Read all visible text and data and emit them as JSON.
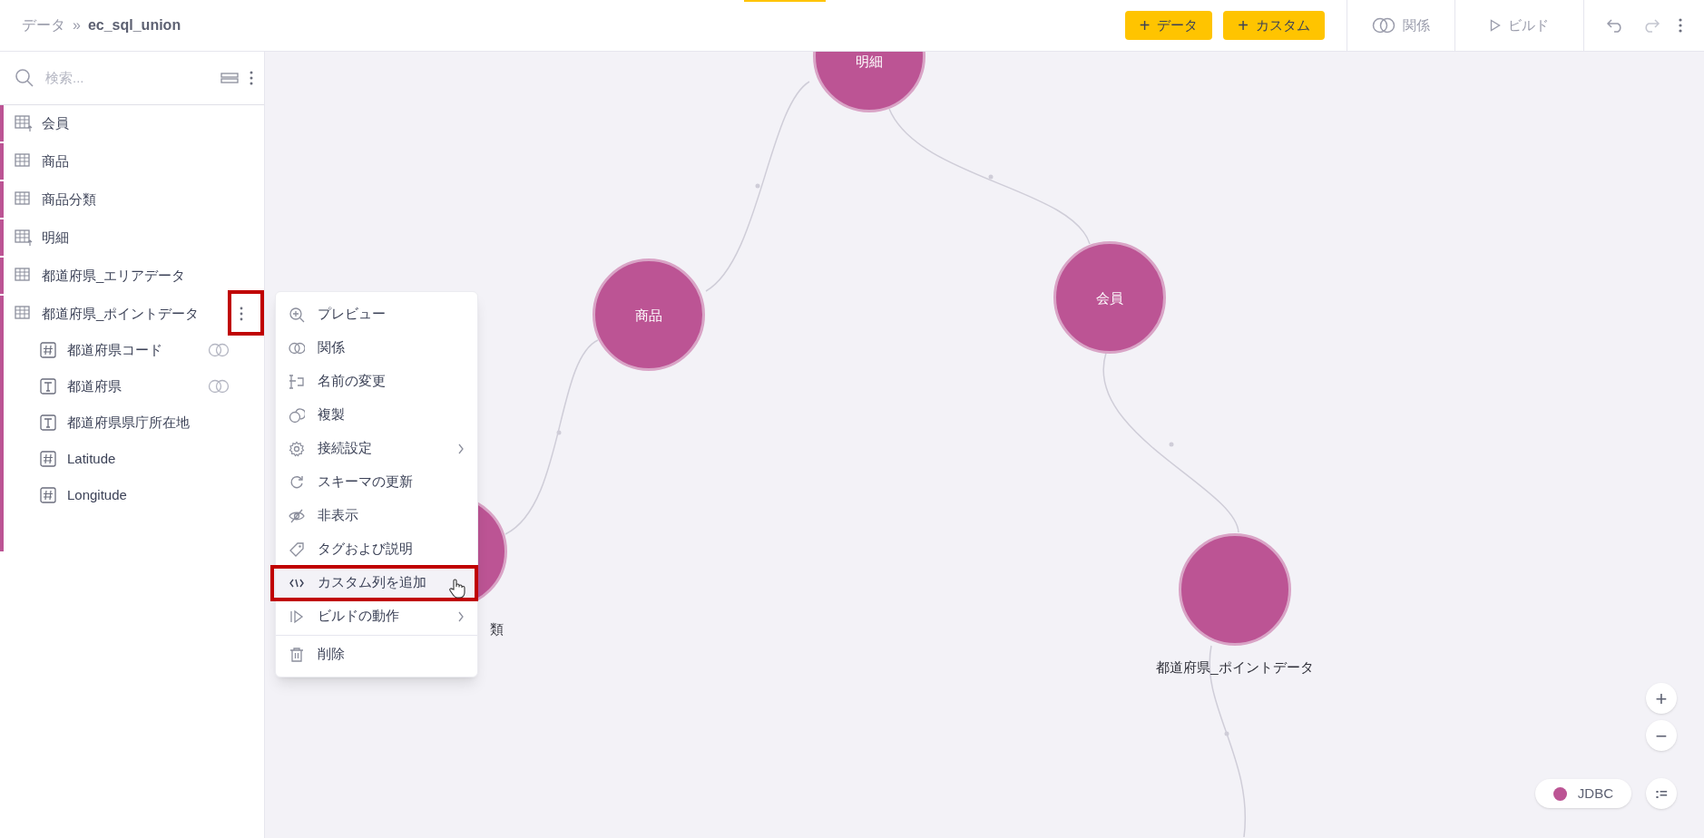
{
  "breadcrumb": {
    "parent": "データ",
    "separator": "»",
    "current": "ec_sql_union"
  },
  "toolbar": {
    "add_buttons": [
      {
        "icon": "+",
        "label": "データ"
      },
      {
        "icon": "+",
        "label": "カスタム"
      }
    ],
    "relations_label": "関係",
    "build_label": "ビルド"
  },
  "sidebar": {
    "search": {
      "placeholder": "検索..."
    },
    "tables": [
      {
        "label": "会員",
        "kind": "upload",
        "expanded": false
      },
      {
        "label": "商品",
        "kind": "table",
        "expanded": false
      },
      {
        "label": "商品分類",
        "kind": "table",
        "expanded": false
      },
      {
        "label": "明細",
        "kind": "upload",
        "expanded": false
      },
      {
        "label": "都道府県_エリアデータ",
        "kind": "table",
        "expanded": false
      },
      {
        "label": "都道府県_ポイントデータ",
        "kind": "table",
        "expanded": true,
        "children": [
          {
            "label": "都道府県コード",
            "kind": "number",
            "related": true
          },
          {
            "label": "都道府県",
            "kind": "text",
            "related": true
          },
          {
            "label": "都道府県県庁所在地",
            "kind": "text",
            "related": false
          },
          {
            "label": "Latitude",
            "kind": "number",
            "related": false
          },
          {
            "label": "Longitude",
            "kind": "number",
            "related": false
          }
        ]
      }
    ]
  },
  "context_menu": {
    "items": [
      {
        "kind": "zoom",
        "label": "プレビュー",
        "submenu": false,
        "highlighted": false
      },
      {
        "kind": "rings",
        "label": "関係",
        "submenu": false,
        "highlighted": false
      },
      {
        "kind": "rename",
        "label": "名前の変更",
        "submenu": false,
        "highlighted": false
      },
      {
        "kind": "copy",
        "label": "複製",
        "submenu": false,
        "highlighted": false
      },
      {
        "kind": "gear",
        "label": "接続設定",
        "submenu": true,
        "highlighted": false
      },
      {
        "kind": "refresh",
        "label": "スキーマの更新",
        "submenu": false,
        "highlighted": false
      },
      {
        "kind": "eye",
        "label": "非表示",
        "submenu": false,
        "highlighted": false
      },
      {
        "kind": "tag",
        "label": "タグおよび説明",
        "submenu": false,
        "highlighted": false
      },
      {
        "kind": "code",
        "label": "カスタム列を追加",
        "submenu": false,
        "highlighted": true
      },
      {
        "kind": "play",
        "label": "ビルドの動作",
        "submenu": true,
        "highlighted": false
      },
      {
        "kind": "trash",
        "label": "削除",
        "submenu": false,
        "highlighted": false,
        "divider_before": true
      }
    ]
  },
  "graph": {
    "nodes": [
      {
        "label": "明細",
        "kind": "inside"
      },
      {
        "label": "商品",
        "kind": "inside"
      },
      {
        "label": "会員",
        "kind": "inside"
      },
      {
        "label": "類",
        "kind": "below"
      },
      {
        "label": "都道府県_ポイントデータ",
        "kind": "below"
      }
    ]
  },
  "zoom_controls": {
    "zoom_in": "+",
    "zoom_out": "−"
  },
  "legend": {
    "label": "JDBC",
    "color": "#bc5494"
  },
  "list_button": ":="
}
